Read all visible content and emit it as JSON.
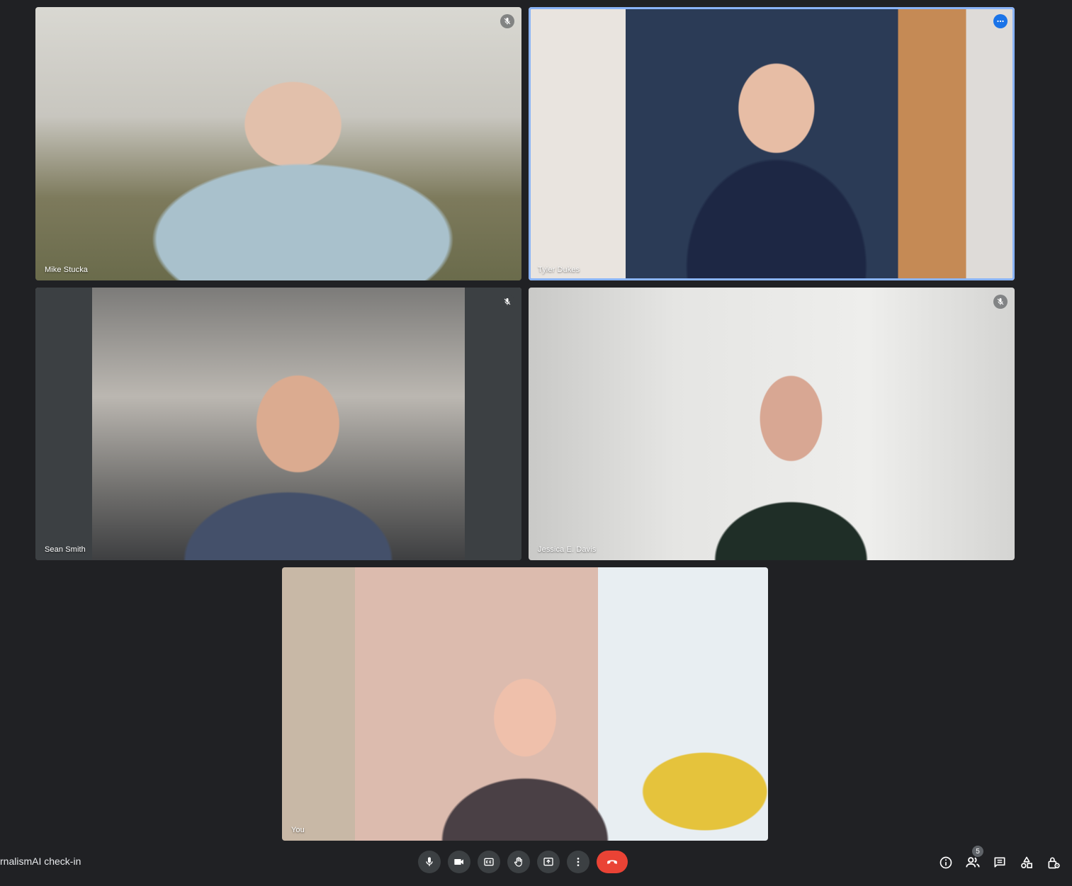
{
  "meeting": {
    "title": "rnalismAI check-in"
  },
  "participants": [
    {
      "name": "Mike Stucka",
      "muted": true
    },
    {
      "name": "Tyler Dukes",
      "speaking": true
    },
    {
      "name": "Sean Smith",
      "muted": true
    },
    {
      "name": "Jessica E. Davis",
      "muted": true
    },
    {
      "name": "You"
    }
  ],
  "toolbar": {
    "participant_count": "5",
    "icons": [
      "mic-icon",
      "camera-icon",
      "captions-icon",
      "raise-hand-icon",
      "present-icon",
      "more-options-icon",
      "end-call-icon"
    ],
    "right_icons": [
      "info-icon",
      "people-icon",
      "chat-icon",
      "activities-icon",
      "host-controls-icon"
    ]
  },
  "colors": {
    "background": "#202124",
    "end_call": "#ea4335",
    "active_border": "#8ab4f8",
    "more_badge": "#1a73e8"
  }
}
